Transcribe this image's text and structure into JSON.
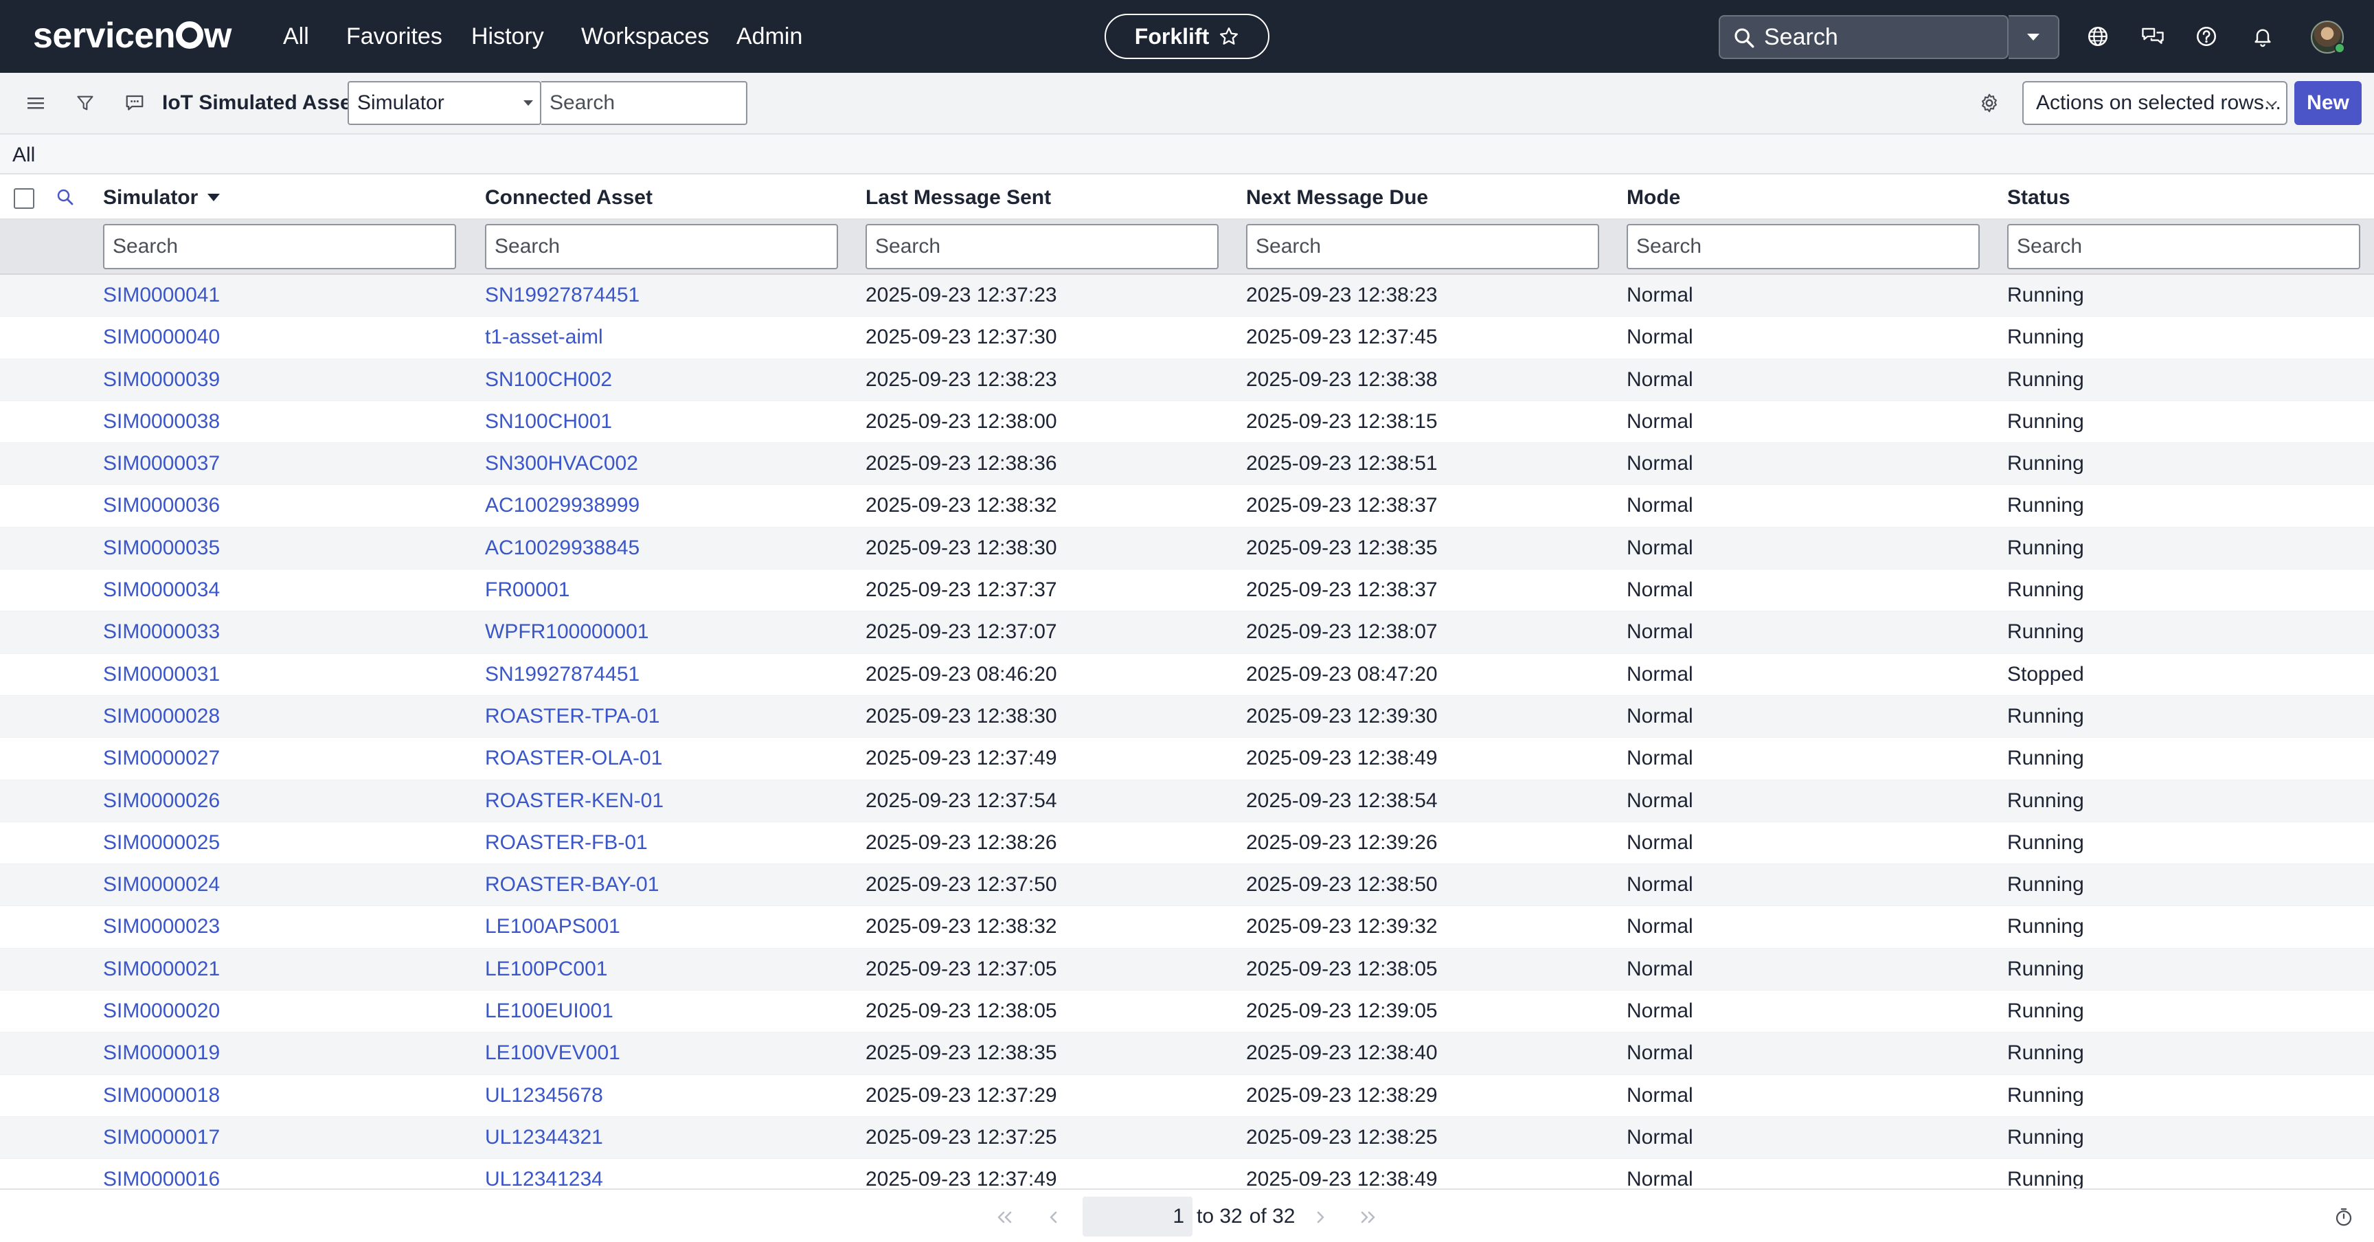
{
  "topbar": {
    "logo_text": "servicenow",
    "nav": [
      "All",
      "Favorites",
      "History",
      "Workspaces",
      "Admin"
    ],
    "workspace_pill": "Forklift",
    "search_placeholder": "Search"
  },
  "toolbar": {
    "list_title": "IoT Simulated Assets",
    "search_field": "Simulator",
    "search_placeholder": "Search",
    "actions_label": "Actions on selected rows...",
    "new_label": "New"
  },
  "breadcrumb": "All",
  "columns": [
    "Simulator",
    "Connected Asset",
    "Last Message Sent",
    "Next Message Due",
    "Mode",
    "Status"
  ],
  "sorted_column": "Simulator",
  "filter_placeholder": "Search",
  "rows": [
    {
      "simulator": "SIM0000041",
      "asset": "SN19927874451",
      "last": "2025-09-23 12:37:23",
      "next": "2025-09-23 12:38:23",
      "mode": "Normal",
      "status": "Running"
    },
    {
      "simulator": "SIM0000040",
      "asset": "t1-asset-aiml",
      "last": "2025-09-23 12:37:30",
      "next": "2025-09-23 12:37:45",
      "mode": "Normal",
      "status": "Running"
    },
    {
      "simulator": "SIM0000039",
      "asset": "SN100CH002",
      "last": "2025-09-23 12:38:23",
      "next": "2025-09-23 12:38:38",
      "mode": "Normal",
      "status": "Running"
    },
    {
      "simulator": "SIM0000038",
      "asset": "SN100CH001",
      "last": "2025-09-23 12:38:00",
      "next": "2025-09-23 12:38:15",
      "mode": "Normal",
      "status": "Running"
    },
    {
      "simulator": "SIM0000037",
      "asset": "SN300HVAC002",
      "last": "2025-09-23 12:38:36",
      "next": "2025-09-23 12:38:51",
      "mode": "Normal",
      "status": "Running"
    },
    {
      "simulator": "SIM0000036",
      "asset": "AC10029938999",
      "last": "2025-09-23 12:38:32",
      "next": "2025-09-23 12:38:37",
      "mode": "Normal",
      "status": "Running"
    },
    {
      "simulator": "SIM0000035",
      "asset": "AC10029938845",
      "last": "2025-09-23 12:38:30",
      "next": "2025-09-23 12:38:35",
      "mode": "Normal",
      "status": "Running"
    },
    {
      "simulator": "SIM0000034",
      "asset": "FR00001",
      "last": "2025-09-23 12:37:37",
      "next": "2025-09-23 12:38:37",
      "mode": "Normal",
      "status": "Running"
    },
    {
      "simulator": "SIM0000033",
      "asset": "WPFR100000001",
      "last": "2025-09-23 12:37:07",
      "next": "2025-09-23 12:38:07",
      "mode": "Normal",
      "status": "Running"
    },
    {
      "simulator": "SIM0000031",
      "asset": "SN19927874451",
      "last": "2025-09-23 08:46:20",
      "next": "2025-09-23 08:47:20",
      "mode": "Normal",
      "status": "Stopped"
    },
    {
      "simulator": "SIM0000028",
      "asset": "ROASTER-TPA-01",
      "last": "2025-09-23 12:38:30",
      "next": "2025-09-23 12:39:30",
      "mode": "Normal",
      "status": "Running"
    },
    {
      "simulator": "SIM0000027",
      "asset": "ROASTER-OLA-01",
      "last": "2025-09-23 12:37:49",
      "next": "2025-09-23 12:38:49",
      "mode": "Normal",
      "status": "Running"
    },
    {
      "simulator": "SIM0000026",
      "asset": "ROASTER-KEN-01",
      "last": "2025-09-23 12:37:54",
      "next": "2025-09-23 12:38:54",
      "mode": "Normal",
      "status": "Running"
    },
    {
      "simulator": "SIM0000025",
      "asset": "ROASTER-FB-01",
      "last": "2025-09-23 12:38:26",
      "next": "2025-09-23 12:39:26",
      "mode": "Normal",
      "status": "Running"
    },
    {
      "simulator": "SIM0000024",
      "asset": "ROASTER-BAY-01",
      "last": "2025-09-23 12:37:50",
      "next": "2025-09-23 12:38:50",
      "mode": "Normal",
      "status": "Running"
    },
    {
      "simulator": "SIM0000023",
      "asset": "LE100APS001",
      "last": "2025-09-23 12:38:32",
      "next": "2025-09-23 12:39:32",
      "mode": "Normal",
      "status": "Running"
    },
    {
      "simulator": "SIM0000021",
      "asset": "LE100PC001",
      "last": "2025-09-23 12:37:05",
      "next": "2025-09-23 12:38:05",
      "mode": "Normal",
      "status": "Running"
    },
    {
      "simulator": "SIM0000020",
      "asset": "LE100EUI001",
      "last": "2025-09-23 12:38:05",
      "next": "2025-09-23 12:39:05",
      "mode": "Normal",
      "status": "Running"
    },
    {
      "simulator": "SIM0000019",
      "asset": "LE100VEV001",
      "last": "2025-09-23 12:38:35",
      "next": "2025-09-23 12:38:40",
      "mode": "Normal",
      "status": "Running"
    },
    {
      "simulator": "SIM0000018",
      "asset": "UL12345678",
      "last": "2025-09-23 12:37:29",
      "next": "2025-09-23 12:38:29",
      "mode": "Normal",
      "status": "Running"
    },
    {
      "simulator": "SIM0000017",
      "asset": "UL12344321",
      "last": "2025-09-23 12:37:25",
      "next": "2025-09-23 12:38:25",
      "mode": "Normal",
      "status": "Running"
    },
    {
      "simulator": "SIM0000016",
      "asset": "UL12341234",
      "last": "2025-09-23 12:37:49",
      "next": "2025-09-23 12:38:49",
      "mode": "Normal",
      "status": "Running"
    }
  ],
  "pagination": {
    "current": "1",
    "to_text": "to 32",
    "of_text": "of 32"
  },
  "colors": {
    "topbar_bg": "#1d2432",
    "link": "#3a56c8",
    "primary_button": "#4b55c7"
  },
  "icons": {
    "toolbar": [
      "hamburger-icon",
      "filter-icon",
      "chat-icon",
      "gear-icon"
    ],
    "topbar": [
      "globe-icon",
      "chat-bubbles-icon",
      "help-icon",
      "bell-icon"
    ],
    "pagination": [
      "first-page-icon",
      "prev-page-icon",
      "next-page-icon",
      "last-page-icon",
      "timer-icon"
    ]
  }
}
